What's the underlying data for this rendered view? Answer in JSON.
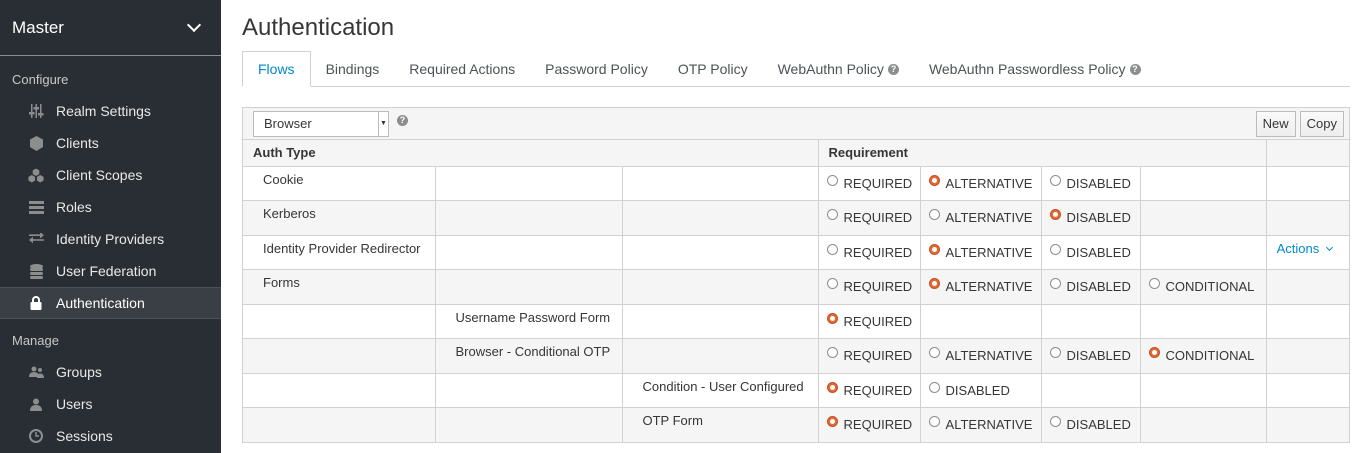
{
  "sidebar": {
    "realm": "Master",
    "configure_title": "Configure",
    "configure_items": [
      {
        "label": "Realm Settings",
        "icon": "sliders-icon"
      },
      {
        "label": "Clients",
        "icon": "cube-icon"
      },
      {
        "label": "Client Scopes",
        "icon": "cubes-icon"
      },
      {
        "label": "Roles",
        "icon": "list-icon"
      },
      {
        "label": "Identity Providers",
        "icon": "exchange-icon"
      },
      {
        "label": "User Federation",
        "icon": "database-icon"
      },
      {
        "label": "Authentication",
        "icon": "lock-icon"
      }
    ],
    "manage_title": "Manage",
    "manage_items": [
      {
        "label": "Groups",
        "icon": "users-icon"
      },
      {
        "label": "Users",
        "icon": "user-icon"
      },
      {
        "label": "Sessions",
        "icon": "clock-icon"
      }
    ]
  },
  "page": {
    "title": "Authentication",
    "tabs": [
      "Flows",
      "Bindings",
      "Required Actions",
      "Password Policy",
      "OTP Policy",
      "WebAuthn Policy",
      "WebAuthn Passwordless Policy"
    ]
  },
  "toolbar": {
    "flow_select": "Browser",
    "new_label": "New",
    "copy_label": "Copy"
  },
  "table": {
    "headers": [
      "Auth Type",
      "Requirement"
    ],
    "actions_label": "Actions",
    "rows": [
      {
        "level": 0,
        "name": "Cookie",
        "options": [
          "REQUIRED",
          "ALTERNATIVE",
          "DISABLED"
        ],
        "selected": "ALTERNATIVE"
      },
      {
        "level": 0,
        "name": "Kerberos",
        "options": [
          "REQUIRED",
          "ALTERNATIVE",
          "DISABLED"
        ],
        "selected": "DISABLED"
      },
      {
        "level": 0,
        "name": "Identity Provider Redirector",
        "options": [
          "REQUIRED",
          "ALTERNATIVE",
          "DISABLED"
        ],
        "selected": "ALTERNATIVE",
        "actions": true
      },
      {
        "level": 0,
        "name": "Forms",
        "options": [
          "REQUIRED",
          "ALTERNATIVE",
          "DISABLED",
          "CONDITIONAL"
        ],
        "selected": "ALTERNATIVE"
      },
      {
        "level": 1,
        "name": "Username Password Form",
        "options": [
          "REQUIRED"
        ],
        "selected": "REQUIRED"
      },
      {
        "level": 1,
        "name": "Browser - Conditional OTP",
        "options": [
          "REQUIRED",
          "ALTERNATIVE",
          "DISABLED",
          "CONDITIONAL"
        ],
        "selected": "CONDITIONAL"
      },
      {
        "level": 2,
        "name": "Condition - User Configured",
        "options": [
          "REQUIRED",
          "DISABLED"
        ],
        "selected": "REQUIRED"
      },
      {
        "level": 2,
        "name": "OTP Form",
        "options": [
          "REQUIRED",
          "ALTERNATIVE",
          "DISABLED"
        ],
        "selected": "REQUIRED"
      }
    ]
  }
}
